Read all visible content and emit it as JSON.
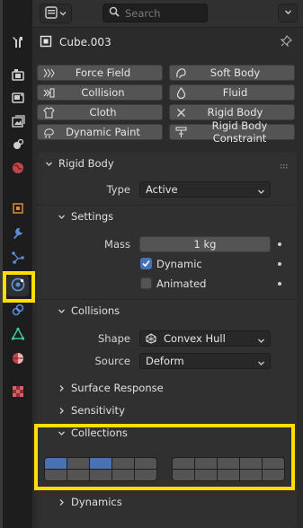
{
  "header": {
    "search_placeholder": "Search"
  },
  "object": {
    "name": "Cube.003"
  },
  "physics_buttons": [
    {
      "label": "Force Field",
      "icon": "force-field-icon"
    },
    {
      "label": "Soft Body",
      "icon": "soft-body-icon"
    },
    {
      "label": "Collision",
      "icon": "collision-icon"
    },
    {
      "label": "Fluid",
      "icon": "fluid-icon"
    },
    {
      "label": "Cloth",
      "icon": "cloth-icon"
    },
    {
      "label": "Rigid Body",
      "icon": "close-icon"
    },
    {
      "label": "Dynamic Paint",
      "icon": "dynamic-paint-icon"
    },
    {
      "label": "Rigid Body Constraint",
      "icon": "rigid-body-constraint-icon"
    }
  ],
  "rigid_body": {
    "title": "Rigid Body",
    "type_label": "Type",
    "type_value": "Active",
    "settings": {
      "title": "Settings",
      "mass_label": "Mass",
      "mass_value": "1 kg",
      "dynamic_label": "Dynamic",
      "dynamic_checked": true,
      "animated_label": "Animated",
      "animated_checked": false
    },
    "collisions": {
      "title": "Collisions",
      "shape_label": "Shape",
      "shape_value": "Convex Hull",
      "source_label": "Source",
      "source_value": "Deform"
    },
    "surface_response_title": "Surface Response",
    "sensitivity_title": "Sensitivity",
    "collections": {
      "title": "Collections",
      "left_grid_active": [
        0,
        2
      ],
      "right_grid_active": []
    },
    "dynamics_title": "Dynamics"
  },
  "colors": {
    "accent": "#4772b3",
    "highlight": "#ffdf00",
    "panel_bg": "#303030",
    "button_bg": "#545454"
  },
  "sidebar_tabs": [
    "tool-icon",
    "render-icon",
    "output-icon",
    "view-layer-icon",
    "scene-icon",
    "world-icon",
    "object-icon",
    "modifier-icon",
    "particles-icon",
    "physics-icon",
    "constraints-icon",
    "object-data-icon",
    "material-icon",
    "texture-icon"
  ],
  "active_tab": "physics-icon"
}
